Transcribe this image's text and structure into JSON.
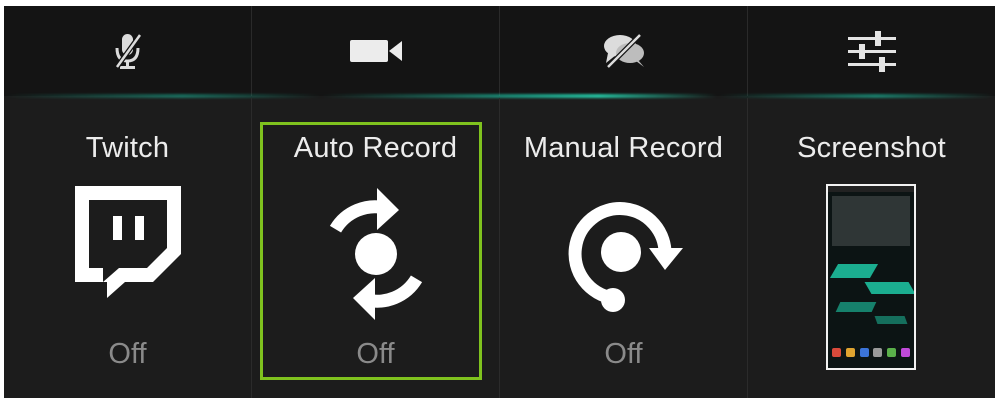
{
  "toolbar": {
    "buttons": [
      {
        "icon": "mic-off-icon"
      },
      {
        "icon": "video-camera-icon"
      },
      {
        "icon": "chat-off-icon"
      },
      {
        "icon": "sliders-icon"
      }
    ]
  },
  "tiles": [
    {
      "title": "Twitch",
      "status": "Off",
      "icon": "twitch-icon"
    },
    {
      "title": "Auto Record",
      "status": "Off",
      "icon": "auto-record-icon",
      "selected": true
    },
    {
      "title": "Manual Record",
      "status": "Off",
      "icon": "manual-record-icon"
    },
    {
      "title": "Screenshot",
      "icon": "screenshot-thumbnail"
    }
  ],
  "colors": {
    "background": "#1c1c1c",
    "toolbar": "#141414",
    "selection": "#7fc21e",
    "accent": "#1ec9a6",
    "title_text": "#ececec",
    "status_text": "#8a8a8a"
  }
}
